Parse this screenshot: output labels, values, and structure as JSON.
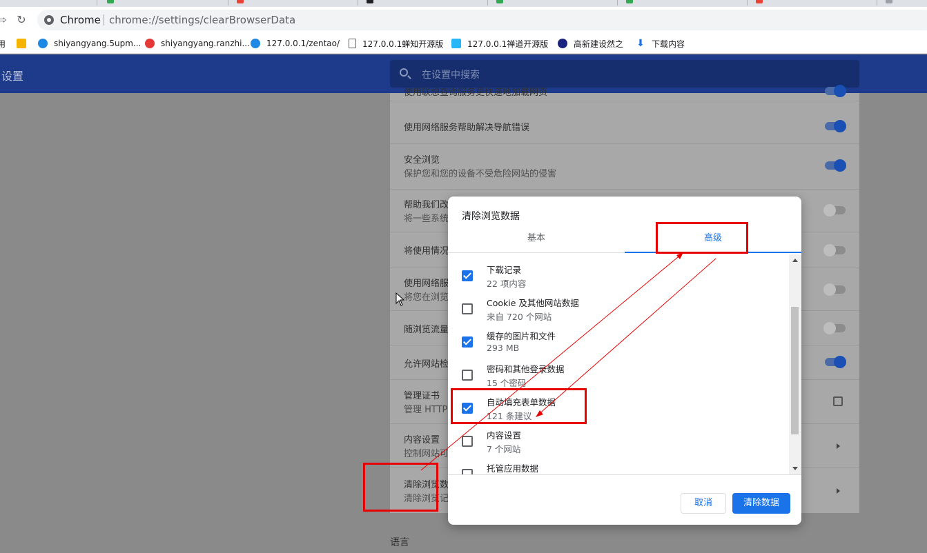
{
  "browser": {
    "site_label": "Chrome",
    "url": "chrome://settings/clearBrowserData"
  },
  "bookmarks": [
    {
      "label": "用",
      "icon": "app-icon",
      "color": "#5f6368"
    },
    {
      "label": "",
      "icon": "note-icon",
      "color": "#f4b400"
    },
    {
      "label": "shiyangyang.5upm...",
      "icon": "zentao-icon",
      "color": "#1e88e5"
    },
    {
      "label": "shiyangyang.ranzhi...",
      "icon": "ranzhi-icon",
      "color": "#e53935"
    },
    {
      "label": "127.0.0.1/zentao/",
      "icon": "zentao-icon",
      "color": "#1e88e5"
    },
    {
      "label": "127.0.0.1蝉知开源版",
      "icon": "page-icon",
      "color": "#5f6368"
    },
    {
      "label": "127.0.0.1禅道开源版",
      "icon": "note-icon",
      "color": "#29b6f6"
    },
    {
      "label": "高新建设然之",
      "icon": "globe-icon",
      "color": "#1a237e"
    },
    {
      "label": "下载内容",
      "icon": "download-icon",
      "color": "#1a73e8"
    }
  ],
  "settings": {
    "title": "设置",
    "search_placeholder": "在设置中搜索",
    "rows": [
      {
        "t1": "使用联想查询服务更快速地加载网页",
        "t2": "",
        "control": "on"
      },
      {
        "t1": "使用网络服务帮助解决导航错误",
        "t2": "",
        "control": "on"
      },
      {
        "t1": "安全浏览",
        "t2": "保护您和您的设备不受危险网站的侵害",
        "control": "on"
      },
      {
        "t1": "帮助我们改",
        "t2": "将一些系统",
        "control": "off"
      },
      {
        "t1": "将使用情况",
        "t2": "",
        "control": "off"
      },
      {
        "t1": "使用网络服",
        "t2": "将您在浏览",
        "control": "off"
      },
      {
        "t1": "随浏览流量",
        "t2": "",
        "control": "off"
      },
      {
        "t1": "允许网站检",
        "t2": "",
        "control": "on"
      },
      {
        "t1": "管理证书",
        "t2": "管理 HTTP",
        "control": "external"
      },
      {
        "t1": "内容设置",
        "t2": "控制网站可",
        "control": "arrow"
      },
      {
        "t1": "清除浏览数",
        "t2": "清除浏览记",
        "control": "arrow"
      }
    ],
    "section_language": "语言"
  },
  "dialog": {
    "title": "清除浏览数据",
    "tab_basic": "基本",
    "tab_advanced": "高级",
    "items": [
      {
        "label": "下载记录",
        "sub": "22 项内容",
        "checked": true
      },
      {
        "label": "Cookie 及其他网站数据",
        "sub": "来自 720 个网站",
        "checked": false
      },
      {
        "label": "缓存的图片和文件",
        "sub": "293 MB",
        "checked": true
      },
      {
        "label": "密码和其他登录数据",
        "sub": "15 个密码",
        "checked": false
      },
      {
        "label": "自动填充表单数据",
        "sub": "121 条建议",
        "checked": true
      },
      {
        "label": "内容设置",
        "sub": "7 个网站",
        "checked": false
      },
      {
        "label": "托管应用数据",
        "sub": "",
        "checked": false
      }
    ],
    "cancel_label": "取消",
    "clear_label": "清除数据"
  },
  "colors": {
    "header": "#1e3a8a",
    "accent": "#1a73e8",
    "annotation": "#e60000"
  }
}
